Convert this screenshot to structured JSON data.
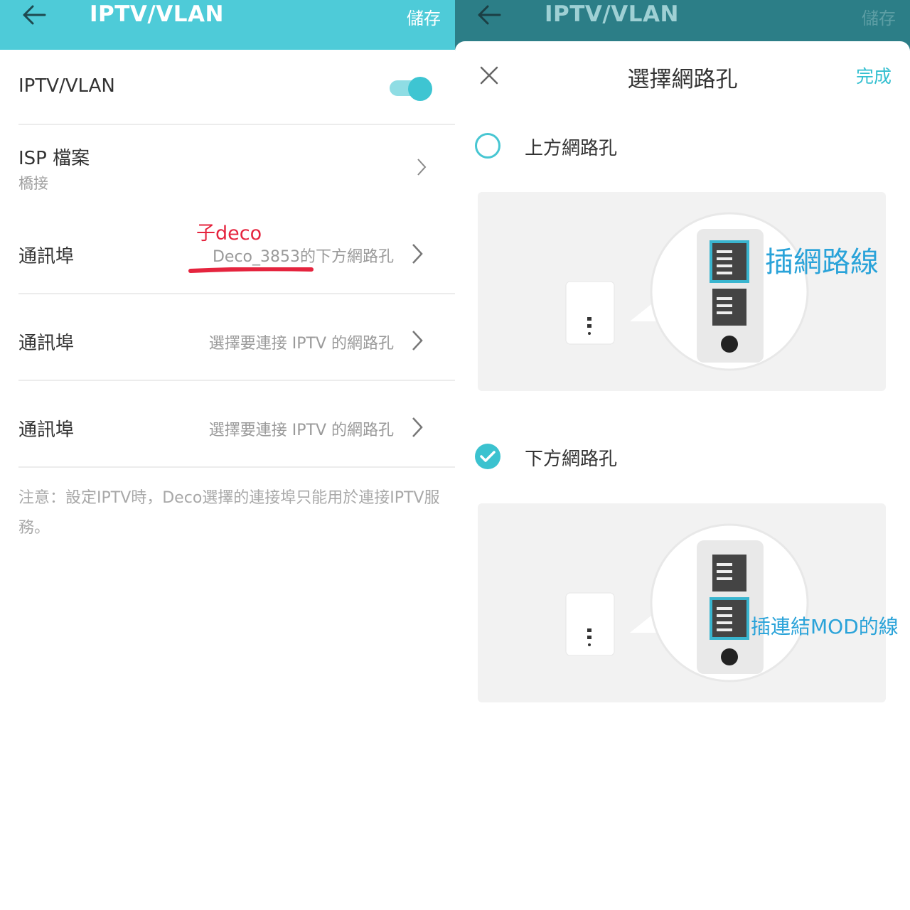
{
  "left": {
    "header": {
      "title": "IPTV/VLAN",
      "save_label": "儲存"
    },
    "iptv_toggle": {
      "label": "IPTV/VLAN",
      "on": true
    },
    "isp_profile": {
      "label": "ISP 檔案",
      "value": "橋接"
    },
    "annotation": "子deco",
    "ports": [
      {
        "label": "通訊埠",
        "value": "Deco_3853的下方網路孔"
      },
      {
        "label": "通訊埠",
        "value": "選擇要連接 IPTV 的網路孔"
      },
      {
        "label": "通訊埠",
        "value": "選擇要連接 IPTV 的網路孔"
      }
    ],
    "note": "注意：設定IPTV時，Deco選擇的連接埠只能用於連接IPTV服務。"
  },
  "right": {
    "header": {
      "title": "IPTV/VLAN",
      "save_label": "儲存"
    },
    "sheet": {
      "title": "選擇網路孔",
      "done_label": "完成",
      "options": [
        {
          "label": "上方網路孔",
          "selected": false,
          "callout": "插網路線"
        },
        {
          "label": "下方網路孔",
          "selected": true,
          "callout": "插連結MOD的線"
        }
      ]
    }
  },
  "colors": {
    "header": "#4ecbd8",
    "accent": "#3bc2cf",
    "annotation_red": "#e5243e",
    "callout_blue": "#2aa3d9"
  },
  "icons": [
    "back-arrow-icon",
    "chevron-right-icon",
    "close-icon",
    "check-icon"
  ]
}
